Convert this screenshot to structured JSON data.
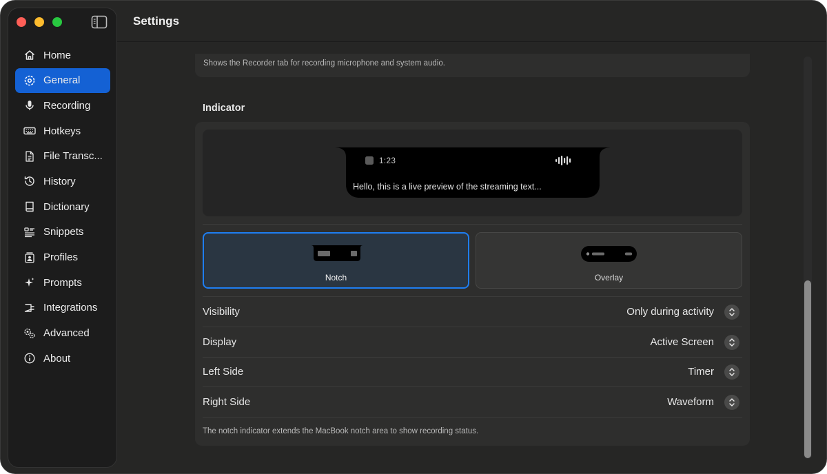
{
  "window": {
    "title": "Settings"
  },
  "sidebar": {
    "items": [
      {
        "label": "Home",
        "icon": "house-icon"
      },
      {
        "label": "General",
        "icon": "gear-icon",
        "active": true
      },
      {
        "label": "Recording",
        "icon": "microphone-icon"
      },
      {
        "label": "Hotkeys",
        "icon": "keyboard-icon"
      },
      {
        "label": "File Transc...",
        "icon": "document-icon"
      },
      {
        "label": "History",
        "icon": "clock-history-icon"
      },
      {
        "label": "Dictionary",
        "icon": "book-icon"
      },
      {
        "label": "Snippets",
        "icon": "list-icon"
      },
      {
        "label": "Profiles",
        "icon": "profile-badge-icon"
      },
      {
        "label": "Prompts",
        "icon": "sparkle-icon"
      },
      {
        "label": "Integrations",
        "icon": "plug-icon"
      },
      {
        "label": "Advanced",
        "icon": "gears-icon"
      },
      {
        "label": "About",
        "icon": "info-icon"
      }
    ]
  },
  "recorder_section": {
    "description": "Shows the Recorder tab for recording microphone and system audio."
  },
  "indicator": {
    "title": "Indicator",
    "preview": {
      "timer": "1:23",
      "streaming_text": "Hello, this is a live preview of the streaming text..."
    },
    "modes": [
      {
        "label": "Notch",
        "selected": true
      },
      {
        "label": "Overlay",
        "selected": false
      }
    ],
    "rows": [
      {
        "label": "Visibility",
        "value": "Only during activity"
      },
      {
        "label": "Display",
        "value": "Active Screen"
      },
      {
        "label": "Left Side",
        "value": "Timer"
      },
      {
        "label": "Right Side",
        "value": "Waveform"
      }
    ],
    "footnote": "The notch indicator extends the MacBook notch area to show recording status."
  },
  "colors": {
    "accent": "#1461d4",
    "selection_border": "#1e7ef2",
    "window_bg": "#262625",
    "sidebar_bg": "#1c1c1c"
  }
}
